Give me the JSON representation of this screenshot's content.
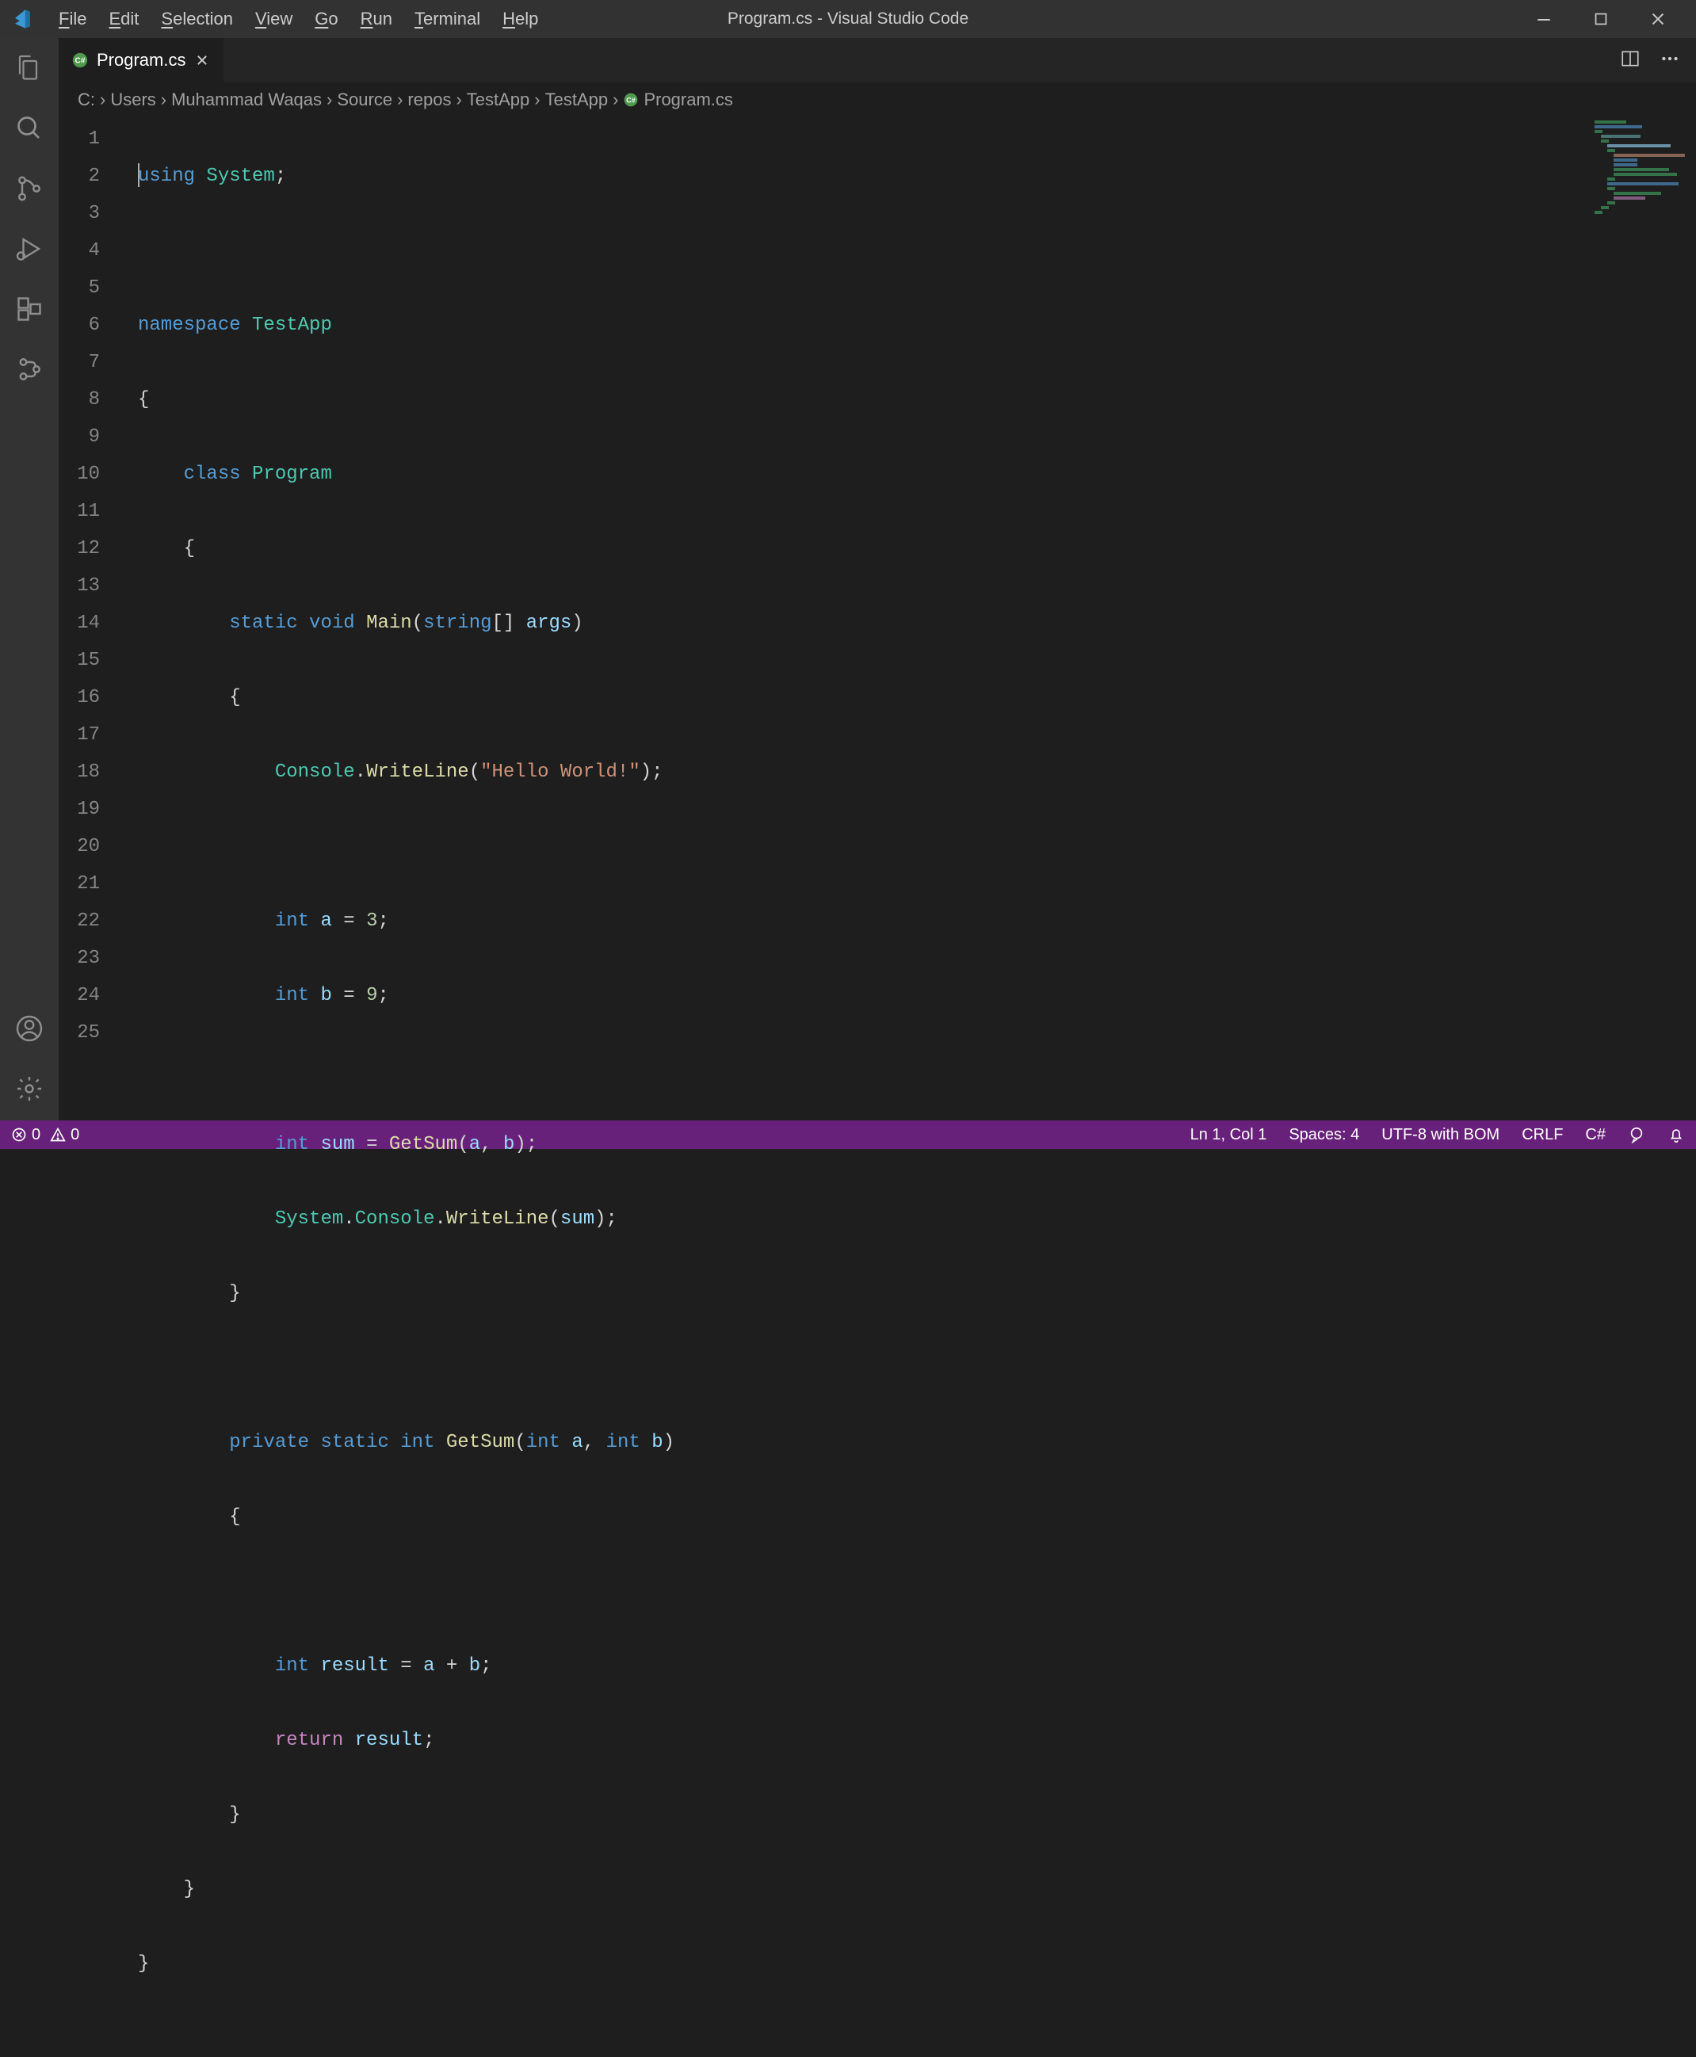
{
  "window": {
    "title": "Program.cs - Visual Studio Code"
  },
  "menu": {
    "file": "File",
    "edit": "Edit",
    "selection": "Selection",
    "view": "View",
    "go": "Go",
    "run": "Run",
    "terminal": "Terminal",
    "help": "Help"
  },
  "tab": {
    "label": "Program.cs"
  },
  "breadcrumb": {
    "p0": "C:",
    "p1": "Users",
    "p2": "Muhammad Waqas",
    "p3": "Source",
    "p4": "repos",
    "p5": "TestApp",
    "p6": "TestApp",
    "p7": "Program.cs"
  },
  "code": {
    "kw_using": "using",
    "ns_system": "System",
    "semi": ";",
    "kw_namespace": "namespace",
    "ns_testapp": "TestApp",
    "brace_o": "{",
    "brace_c": "}",
    "kw_class": "class",
    "cls_program": "Program",
    "kw_static": "static",
    "kw_void": "void",
    "mth_main": "Main",
    "paren_o": "(",
    "paren_c": ")",
    "kw_string": "string",
    "brackets": "[]",
    "var_args": "args",
    "obj_console": "Console",
    "dot": ".",
    "mth_writeline": "WriteLine",
    "str_hello": "\"Hello World!\"",
    "kw_int": "int",
    "var_a": "a",
    "var_b": "b",
    "eq": "=",
    "num_3": "3",
    "num_9": "9",
    "var_sum": "sum",
    "mth_getsum": "GetSum",
    "comma": ",",
    "sp": " ",
    "kw_private": "private",
    "var_result": "result",
    "plus": "+",
    "kw_return": "return"
  },
  "status": {
    "errors": "0",
    "warnings": "0",
    "ln_col": "Ln 1, Col 1",
    "spaces": "Spaces: 4",
    "encoding": "UTF-8 with BOM",
    "eol": "CRLF",
    "lang": "C#"
  }
}
